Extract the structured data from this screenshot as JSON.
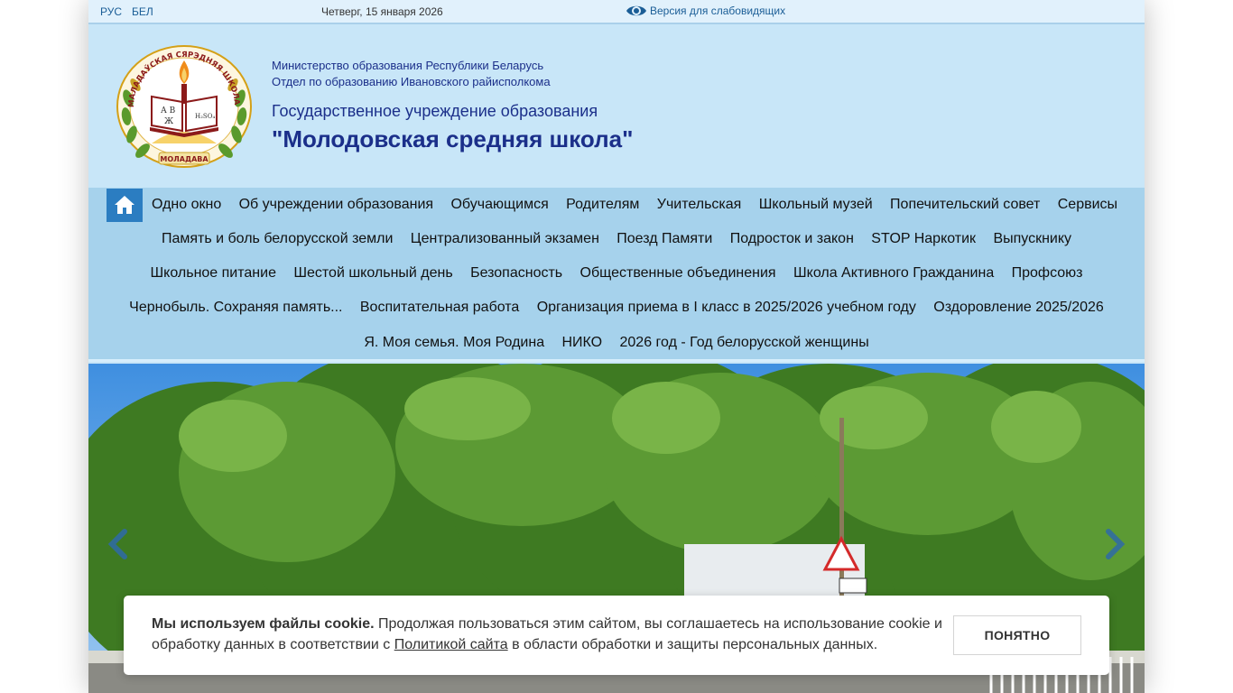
{
  "topbar": {
    "lang_ru": "РУС",
    "lang_be": "БЕЛ",
    "date": "Четверг, 15 января 2026",
    "vision_label": "Версия для слабовидящих"
  },
  "header": {
    "ministry_line1": "Министерство образования Республики Беларусь",
    "ministry_line2": "Отдел по образованию Ивановского райисполкома",
    "institution_type": "Государственное учреждение образования",
    "school_name": "\"Молодовская средняя школа\"",
    "logo_top_text": "МАЛАДАЎСКАЯ СЯРЭДНЯЯ ШКОЛА",
    "logo_bottom_text": "МОЛАДАВА"
  },
  "nav": {
    "row1": [
      "Одно окно",
      "Об учреждении образования",
      "Обучающимся",
      "Родителям",
      "Учительская",
      "Школьный музей",
      "Попечительский совет",
      "Сервисы"
    ],
    "row2": [
      "Память и боль белорусской земли",
      "Централизованный экзамен",
      "Поезд Памяти",
      "Подросток и закон",
      "STOP Наркотик",
      "Выпускнику"
    ],
    "row3": [
      "Школьное питание",
      "Шестой школьный день",
      "Безопасность",
      "Общественные объединения",
      "Школа Активного Гражданина",
      "Профсоюз"
    ],
    "row4": [
      "Чернобыль. Сохраняя память...",
      "Воспитательная работа",
      "Организация приема в I класс в 2025/2026 учебном году",
      "Оздоровление 2025/2026"
    ],
    "row5": [
      "Я. Моя семья. Моя Родина",
      "НИКО",
      "2026 год - Год белорусской женщины"
    ]
  },
  "cookie": {
    "bold": "Мы используем файлы cookie.",
    "text_before_link": " Продолжая пользоваться этим сайтом, вы соглашаетесь на использование cookie и обработку данных в соответствии с ",
    "link": "Политикой сайта",
    "text_after_link": " в области обработки и защиты персональных данных.",
    "button": "ПОНЯТНО"
  },
  "colors": {
    "page_bg": "#c8e6f8",
    "nav_bg": "#a6d2ec",
    "home_btn": "#2b7dc1",
    "heading_text": "#1b2f8a",
    "link": "#1a5d96"
  },
  "icons": {
    "home": "home-icon",
    "vision": "eye-icon",
    "prev": "chevron-left-icon",
    "next": "chevron-right-icon"
  }
}
